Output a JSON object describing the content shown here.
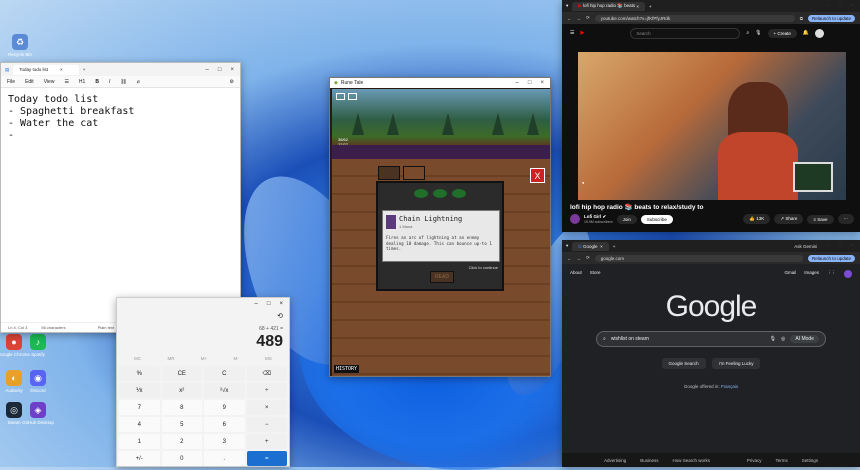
{
  "desktop": {
    "icons": [
      {
        "label": "Recycle Bin",
        "glyph": "♻",
        "color": "#5b8bd6",
        "icon": "recycle-bin-icon"
      },
      {
        "label": "Google Chrome",
        "glyph": "●",
        "color": "#db4437",
        "icon": "chrome-icon"
      },
      {
        "label": "Spotify",
        "glyph": "♪",
        "color": "#1db954",
        "icon": "spotify-icon"
      },
      {
        "label": "Audacity",
        "glyph": "◐",
        "color": "#e8a02a",
        "icon": "audacity-icon"
      },
      {
        "label": "Discord",
        "glyph": "◉",
        "color": "#5865f2",
        "icon": "discord-icon"
      },
      {
        "label": "Steam",
        "glyph": "◎",
        "color": "#1b2838",
        "icon": "steam-icon"
      },
      {
        "label": "GitHub Desktop",
        "glyph": "◈",
        "color": "#6e40c9",
        "icon": "github-desktop-icon"
      }
    ]
  },
  "notepad": {
    "tab": "Today todo list",
    "add": "+",
    "menu": [
      "File",
      "Edit",
      "View"
    ],
    "format": "H1",
    "lines": [
      "Today todo list",
      "- Spaghetti breakfast",
      "- Water the cat",
      "-"
    ],
    "status": [
      "Ln 4, Col 3",
      "56 characters",
      "Plain text",
      "100%",
      "Windows (CRLF)",
      "UTF-8"
    ]
  },
  "calculator": {
    "expression": "68 + 421 =",
    "display": "489",
    "memory": [
      "MC",
      "MR",
      "M+",
      "M-",
      "MS"
    ],
    "keys": [
      "%",
      "CE",
      "C",
      "⌫",
      "⅟x",
      "x²",
      "²√x",
      "÷",
      "7",
      "8",
      "9",
      "×",
      "4",
      "5",
      "6",
      "−",
      "1",
      "2",
      "3",
      "+",
      "+/-",
      "0",
      ".",
      "="
    ]
  },
  "game": {
    "title": "Rune Tale",
    "hud": [
      "38/62",
      "22/27"
    ],
    "close": "X",
    "spell": "Chain Lightning",
    "spell_sub": "1 Mana",
    "desc": "Fires an arc of lightning at an enemy dealing 10 damage. This can bounce up-to 1 times.",
    "continue": "Click to continue",
    "read": "READ",
    "history": "HISTORY"
  },
  "youtube": {
    "tab": "lofi hip hop radio 📚 beats",
    "url": "youtube.com/watch?v=jfKfPfyJRdk",
    "relaunch": "Relaunch to update",
    "ask": "Ask Gemini",
    "search": "Search",
    "create": "+ Create",
    "title": "lofi hip hop radio 📚 beats to relax/study to",
    "channel": "Lofi Girl ✔",
    "subs": "15.9M subscribers",
    "join": "Join",
    "subscribe": "Subscribe",
    "likes": "13K",
    "share": "Share",
    "save": "Save",
    "more": "⋯"
  },
  "google": {
    "tab": "Google",
    "url": "google.com",
    "relaunch": "Relaunch to update",
    "ask": "Ask Gemini",
    "links_left": [
      "About",
      "Store"
    ],
    "links_right": [
      "Gmail",
      "Images"
    ],
    "logo": "Google",
    "query": "wishlist on steam",
    "ai": "AI Mode",
    "btn1": "Google Search",
    "btn2": "I'm Feeling Lucky",
    "offered": "Google offered in: ",
    "lang": "Français",
    "footer": [
      "Advertising",
      "Business",
      "How Search works",
      "Privacy",
      "Terms",
      "Settings"
    ]
  }
}
